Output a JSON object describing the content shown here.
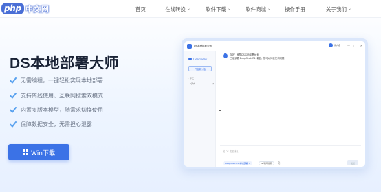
{
  "nav": {
    "logo_text": "php",
    "logo_cn": "中文网",
    "items": [
      {
        "label": "首页",
        "has_dropdown": false
      },
      {
        "label": "在线转换",
        "has_dropdown": true
      },
      {
        "label": "软件下载",
        "has_dropdown": true
      },
      {
        "label": "软件商城",
        "has_dropdown": true
      },
      {
        "label": "操作手册",
        "has_dropdown": false
      },
      {
        "label": "关于我们",
        "has_dropdown": true
      }
    ]
  },
  "hero": {
    "title": "DS本地部署大师",
    "features": [
      "无需编程，一键轻松实现本地部署",
      "支持离线使用、互联网搜索双模式",
      "内置多版本模型，随需求切换使用",
      "保障数据安全，无需担心泄露"
    ],
    "download_button": "Win下载"
  },
  "app_preview": {
    "title": "DS本地部署大师",
    "username": "用户名",
    "window_controls": [
      "—",
      "▢",
      "✕"
    ],
    "brand": "DeepSeek",
    "new_chat": "开启新对话",
    "sidebar_items": [
      "· 今天",
      "· 7天内"
    ],
    "greeting": [
      "你好，我是DS本地部署大师",
      "已经部署 DeepSeek-R1 模型，您可以问我任何问题"
    ],
    "input_placeholder": "给 DS 发送消息",
    "model_chip": "DeepSeek-R1 本地部署 ⌄",
    "net_chip": "⊕ 联网搜索",
    "send_label": "发送"
  },
  "colors": {
    "accent": "#3b72e6",
    "title": "#1a2336",
    "check": "#5aa2ef"
  }
}
